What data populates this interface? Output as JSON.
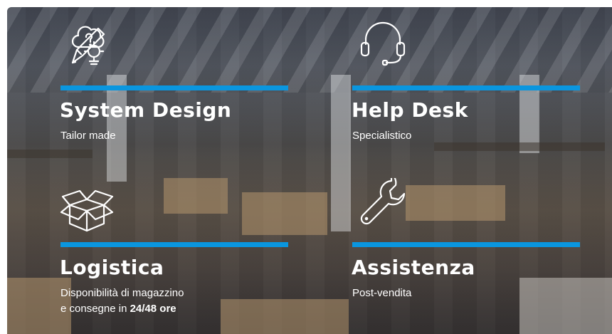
{
  "accent_color": "#0a96df",
  "cards": [
    {
      "icon": "design-idea-icon",
      "title": "System Design",
      "subtitle_line1": "Tailor made"
    },
    {
      "icon": "headset-icon",
      "title": "Help Desk",
      "subtitle_line1": "Specialistico"
    },
    {
      "icon": "box-icon",
      "title": "Logistica",
      "subtitle_line1": "Disponibilità di magazzino",
      "subtitle_line2_prefix": "e consegne in ",
      "subtitle_line2_bold": "24/48 ore"
    },
    {
      "icon": "wrench-icon",
      "title": "Assistenza",
      "subtitle_line1": "Post-vendita"
    }
  ]
}
